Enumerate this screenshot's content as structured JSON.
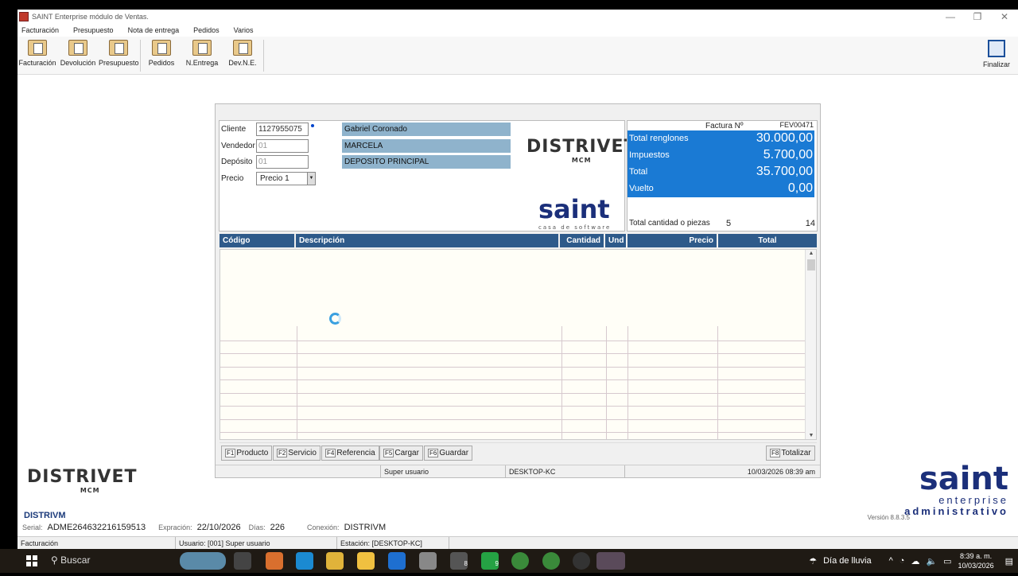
{
  "window": {
    "title": "SAINT Enterprise módulo de Ventas.",
    "min": "—",
    "max": "❐",
    "close": "✕"
  },
  "menu": [
    "Facturación",
    "Presupuesto",
    "Nota de entrega",
    "Pedidos",
    "Varios"
  ],
  "toolbar": [
    "Facturación",
    "Devolución",
    "Presupuesto",
    "Pedidos",
    "N.Entrega",
    "Dev.N.E."
  ],
  "finalizar": "Finalizar",
  "form": {
    "cliente_label": "Cliente",
    "cliente": "1127955075",
    "cliente_name": "Gabriel Coronado",
    "vendedor_label": "Vendedor",
    "vendedor": "01",
    "vendedor_name": "MARCELA",
    "deposito_label": "Depósito",
    "deposito": "01",
    "deposito_name": "DEPOSITO PRINCIPAL",
    "precio_label": "Precio",
    "precio": "Precio 1",
    "brand": "DISTRIVET",
    "brand_sub": "MCM",
    "saint": "saint",
    "saint_sub": "casa de software"
  },
  "totals": {
    "factura_label": "Factura Nº",
    "factura": "FEV00471",
    "renglones_label": "Total renglones",
    "renglones": "30.000,00",
    "impuestos_label": "Impuestos",
    "impuestos": "5.700,00",
    "total_label": "Total",
    "total": "35.700,00",
    "vuelto_label": "Vuelto",
    "vuelto": "0,00",
    "cantidad_label": "Total cantidad o piezas",
    "cantidad": "5",
    "piezas": "14"
  },
  "columns": [
    "Código",
    "Descripción",
    "Cantidad",
    "Und",
    "Precio",
    "Total"
  ],
  "buttons": [
    {
      "key": "F1",
      "label": "Producto"
    },
    {
      "key": "F2",
      "label": "Servicio"
    },
    {
      "key": "F4",
      "label": "Referencia"
    },
    {
      "key": "F5",
      "label": "Cargar"
    },
    {
      "key": "F6",
      "label": "Guardar"
    }
  ],
  "totalizar": {
    "key": "F8",
    "label": "Totalizar"
  },
  "form_status": {
    "user": "Super usuario",
    "station": "DESKTOP-KC",
    "datetime": "10/03/2026 08:39 am"
  },
  "company": "DISTRIVM",
  "serial_label": "Serial:",
  "serial": "ADME264632216159513",
  "exp_label": "Expración:",
  "exp": "22/10/2026",
  "dias_label": "Días:",
  "dias": "226",
  "con_label": "Conexión:",
  "con": "DISTRIVM",
  "saint_logo": {
    "big": "saint",
    "l2": "enterprise",
    "l3": "administrativo",
    "version": "Versión 8.8.3.5"
  },
  "app_status": {
    "module": "Facturación",
    "user": "Usuario: [001]  Super usuario",
    "station": "Estación: [DESKTOP-KC]"
  },
  "taskbar": {
    "search": "Buscar",
    "weather": "Día de lluvia",
    "time": "8:39 a. m.",
    "date": "10/03/2026",
    "badge1": "8",
    "badge2": "9"
  },
  "colors": {
    "accent": "#1a7ad4",
    "header": "#2e5a8a",
    "brand": "#1b2f7a"
  }
}
